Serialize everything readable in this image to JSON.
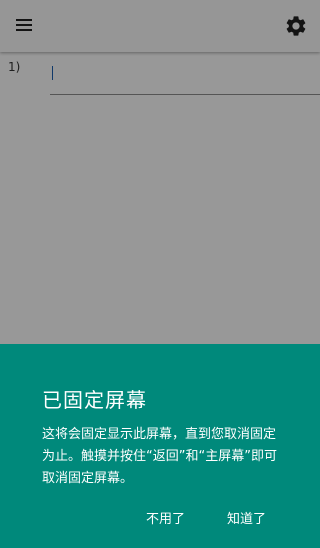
{
  "editor": {
    "line_number": "1)"
  },
  "icons": {
    "menu": "menu-icon",
    "settings": "gear-icon"
  },
  "pin_dialog": {
    "title": "已固定屏幕",
    "message": "这将会固定显示此屏幕，直到您取消固定为止。触摸并按住“返回”和“主屏幕”即可取消固定屏幕。",
    "decline_label": "不用了",
    "confirm_label": "知道了"
  },
  "colors": {
    "dialog_background": "#00897b",
    "dialog_text": "#ffffff"
  }
}
